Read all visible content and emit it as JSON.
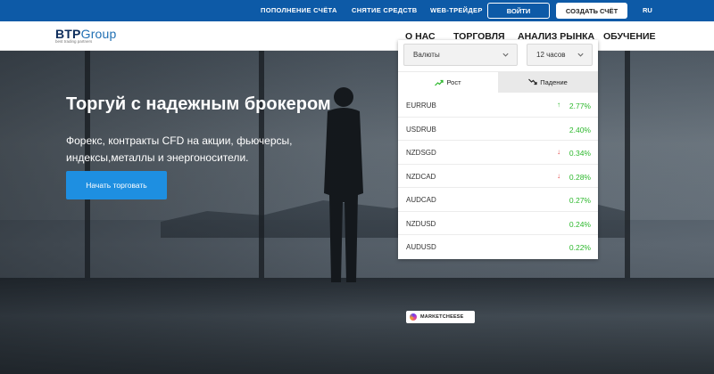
{
  "topbar": {
    "links": [
      "ПОПОЛНЕНИЕ СЧЁТА",
      "СНЯТИЕ СРЕДСТВ",
      "WEB-ТРЕЙДЕР"
    ],
    "login_label": "ВОЙТИ",
    "create_label": "СОЗДАТЬ СЧЁТ",
    "lang": "RU"
  },
  "logo": {
    "brand_part1": "BTP",
    "brand_part2": "Group",
    "tagline": "best trading partners"
  },
  "nav": {
    "items": [
      "О НАС",
      "ТОРГОВЛЯ",
      "АНАЛИЗ РЫНКА",
      "ОБУЧЕНИЕ"
    ]
  },
  "hero": {
    "headline": "Торгуй с надежным брокером",
    "subtext": "Форекс, контракты CFD на акции, фьючерсы, индексы,металлы и энергоносители.",
    "cta_label": "Начать торговать"
  },
  "widget": {
    "category_select": "Валюты",
    "period_select": "12 часов",
    "tab_rise": "Рост",
    "tab_fall": "Падение",
    "rows": [
      {
        "symbol": "EURRUB",
        "direction": "up",
        "change": "2.77%"
      },
      {
        "symbol": "USDRUB",
        "direction": "none",
        "change": "2.40%"
      },
      {
        "symbol": "NZDSGD",
        "direction": "down",
        "change": "0.34%"
      },
      {
        "symbol": "NZDCAD",
        "direction": "down",
        "change": "0.28%"
      },
      {
        "symbol": "AUDCAD",
        "direction": "none",
        "change": "0.27%"
      },
      {
        "symbol": "NZDUSD",
        "direction": "none",
        "change": "0.24%"
      },
      {
        "symbol": "AUDUSD",
        "direction": "none",
        "change": "0.22%"
      }
    ],
    "provider_badge": "MARKETCHEESE"
  },
  "colors": {
    "topbar": "#0d5aa7",
    "cta": "#1e8fe1",
    "positive": "#2db82d",
    "negative": "#e04040"
  }
}
